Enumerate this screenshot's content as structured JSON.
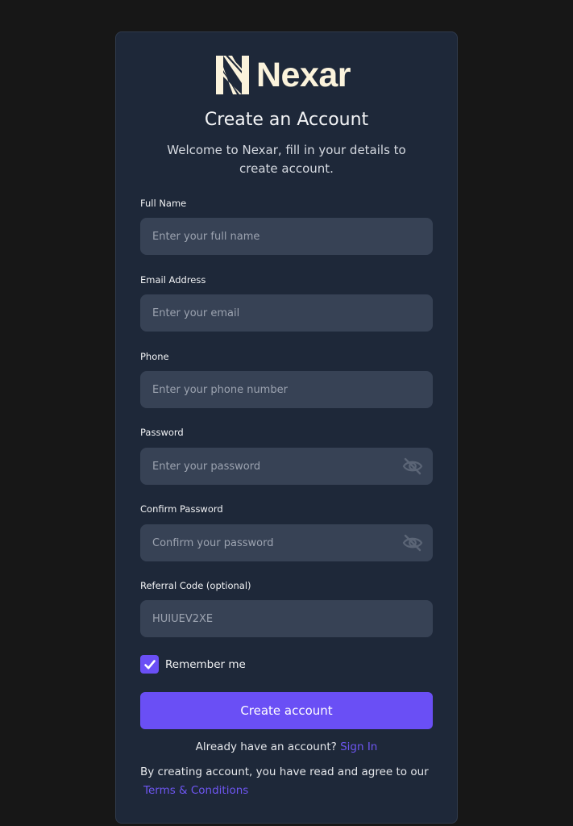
{
  "brand": {
    "name": "Nexar",
    "logo_icon": "nexar-logo-icon"
  },
  "header": {
    "title": "Create an Account",
    "subtitle": "Welcome to Nexar, fill in your details to create account."
  },
  "fields": {
    "full_name": {
      "label": "Full Name",
      "placeholder": "Enter your full name"
    },
    "email": {
      "label": "Email Address",
      "placeholder": "Enter your email"
    },
    "phone": {
      "label": "Phone",
      "placeholder": "Enter your phone number"
    },
    "password": {
      "label": "Password",
      "placeholder": "Enter your password",
      "icon": "eye-off-icon"
    },
    "confirm_password": {
      "label": "Confirm Password",
      "placeholder": "Confirm your password",
      "icon": "eye-off-icon"
    },
    "referral": {
      "label": "Referral Code (optional)",
      "value": "HUIUEV2XE"
    }
  },
  "remember": {
    "label": "Remember me",
    "checked": true
  },
  "submit_label": "Create account",
  "signin": {
    "prompt": "Already have an account?",
    "link": "Sign In"
  },
  "terms": {
    "text": "By creating account, you have read and agree to our",
    "link": "Terms & Conditions"
  },
  "colors": {
    "page_bg": "#171717",
    "card_bg": "#1e2839",
    "input_bg": "#374255",
    "accent": "#6a4ff5",
    "link": "#6e56f2",
    "logo": "#fbf3dc"
  }
}
